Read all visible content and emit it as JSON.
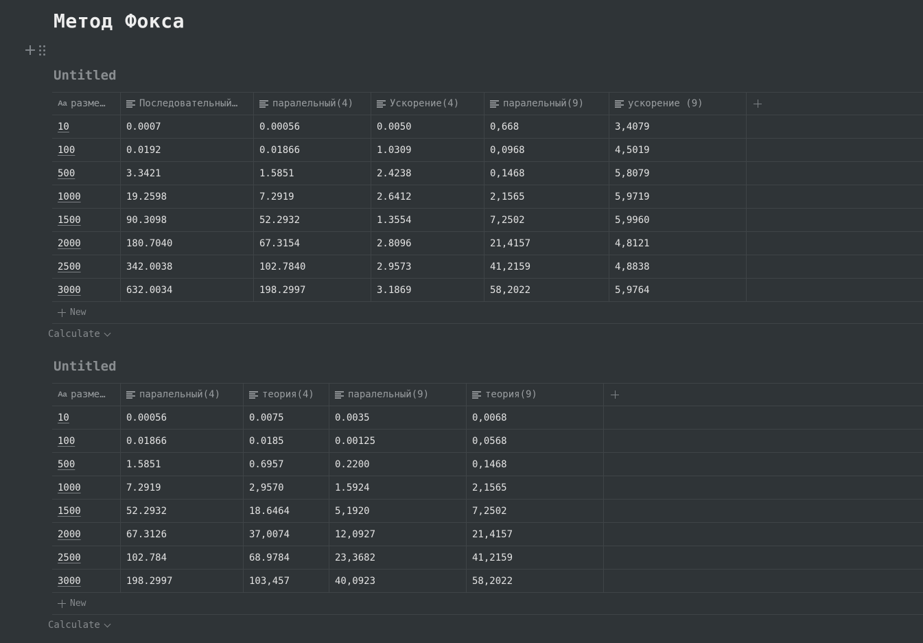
{
  "page": {
    "title": "Метод Фокса"
  },
  "table1": {
    "title": "Untitled",
    "columns": [
      "разме…",
      "Последовательный…",
      "паралельный(4)",
      "Ускорение(4)",
      "паралельный(9)",
      "ускорение (9)"
    ],
    "rows": [
      [
        "10",
        "0.0007",
        "0.00056",
        "0.0050",
        "0,668",
        "3,4079"
      ],
      [
        "100",
        "0.0192",
        "0.01866",
        "1.0309",
        "0,0968",
        "4,5019"
      ],
      [
        "500",
        "3.3421",
        "1.5851",
        "2.4238",
        "0,1468",
        "5,8079"
      ],
      [
        "1000",
        "19.2598",
        "7.2919",
        "2.6412",
        "2,1565",
        "5,9719"
      ],
      [
        "1500",
        "90.3098",
        "52.2932",
        "1.3554",
        "7,2502",
        "5,9960"
      ],
      [
        "2000",
        "180.7040",
        "67.3154",
        "2.8096",
        "21,4157",
        "4,8121"
      ],
      [
        "2500",
        "342.0038",
        "102.7840",
        "2.9573",
        "41,2159",
        "4,8838"
      ],
      [
        "3000",
        "632.0034",
        "198.2997",
        "3.1869",
        "58,2022",
        "5,9764"
      ]
    ],
    "new_label": "New",
    "calculate_label": "Calculate"
  },
  "table2": {
    "title": "Untitled",
    "columns": [
      "разме…",
      "паралельный(4)",
      "теория(4)",
      "паралельный(9)",
      "теория(9)"
    ],
    "rows": [
      [
        "10",
        "0.00056",
        "0.0075",
        "0.0035",
        "0,0068"
      ],
      [
        "100",
        "0.01866",
        "0.0185",
        "0.00125",
        "0,0568"
      ],
      [
        "500",
        "1.5851",
        "0.6957",
        "0.2200",
        "0,1468"
      ],
      [
        "1000",
        "7.2919",
        "2,9570",
        "1.5924",
        "2,1565"
      ],
      [
        "1500",
        "52.2932",
        "18.6464",
        "5,1920",
        "7,2502"
      ],
      [
        "2000",
        "67.3126",
        "37,0074",
        "12,0927",
        "21,4157"
      ],
      [
        "2500",
        "102.784",
        "68.9784",
        "23,3682",
        "41,2159"
      ],
      [
        "3000",
        "198.2997",
        "103,457",
        "40,0923",
        "58,2022"
      ]
    ],
    "new_label": "New",
    "calculate_label": "Calculate"
  },
  "icons": {
    "title_property": "Aa",
    "text_property": "text-lines-icon",
    "add_column": "plus-icon",
    "add_block": "plus-icon",
    "drag_handle": "drag-handle-icon",
    "chevron": "chevron-down-icon"
  },
  "colors": {
    "background": "#2f3437",
    "text": "#e6e6e6",
    "muted": "#8a8e91",
    "border": "#3f4447"
  }
}
